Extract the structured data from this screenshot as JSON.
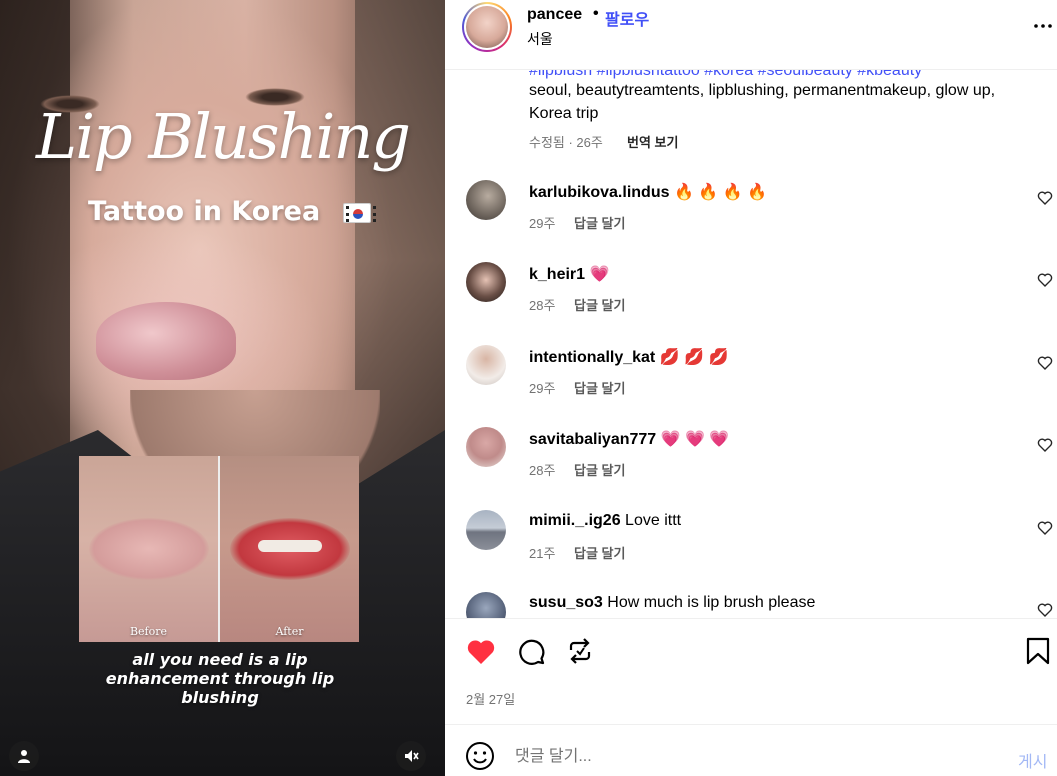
{
  "media": {
    "title_script": "Lip Blushing",
    "title_sub": "Tattoo in Korea",
    "before_label": "Before",
    "after_label": "After",
    "caption": "all you need is a lip enhancement through lip blushing",
    "icons": {
      "user": "user-icon",
      "mute": "speaker-muted-icon",
      "flag": "korea-flag-icon"
    }
  },
  "header": {
    "username": "pancee",
    "separator": "•",
    "follow": "팔로우",
    "location": "서울",
    "more_icon": "more-horizontal-icon"
  },
  "caption": {
    "hashtags": "#lipblush #lipblushtattoo #korea #seoulbeauty #kbeauty",
    "text": "seoul, beautytreamtents, lipblushing, permanentmakeup, glow up, Korea trip",
    "meta": "수정됨 · 26주",
    "translate": "번역 보기"
  },
  "comments": [
    {
      "user": "karlubikova.lindus",
      "text": "🔥 🔥 🔥 🔥",
      "time": "29주",
      "reply": "답글 달기"
    },
    {
      "user": "k_heir1",
      "text": "💗",
      "time": "28주",
      "reply": "답글 달기"
    },
    {
      "user": "intentionally_kat",
      "text": "💋 💋 💋",
      "time": "29주",
      "reply": "답글 달기"
    },
    {
      "user": "savitabaliyan777",
      "text": "💗 💗 💗",
      "time": "28주",
      "reply": "답글 달기"
    },
    {
      "user": "mimii._.ig26",
      "text": "Love ittt",
      "time": "21주",
      "reply": "답글 달기"
    },
    {
      "user": "susu_so3",
      "text": "How much is lip brush please",
      "time": "",
      "reply": ""
    }
  ],
  "actions": {
    "like_icon": "heart-filled-icon",
    "comment_icon": "comment-icon",
    "share_icon": "repost-icon",
    "save_icon": "bookmark-icon",
    "date": "2월 27일"
  },
  "composer": {
    "placeholder": "댓글 달기...",
    "post_label": "게시",
    "emoji_icon": "emoji-icon"
  },
  "colors": {
    "link_blue": "#4150f7",
    "like_red": "#ff3040",
    "post_disabled": "#a3b8f5",
    "muted_text": "#737373"
  }
}
